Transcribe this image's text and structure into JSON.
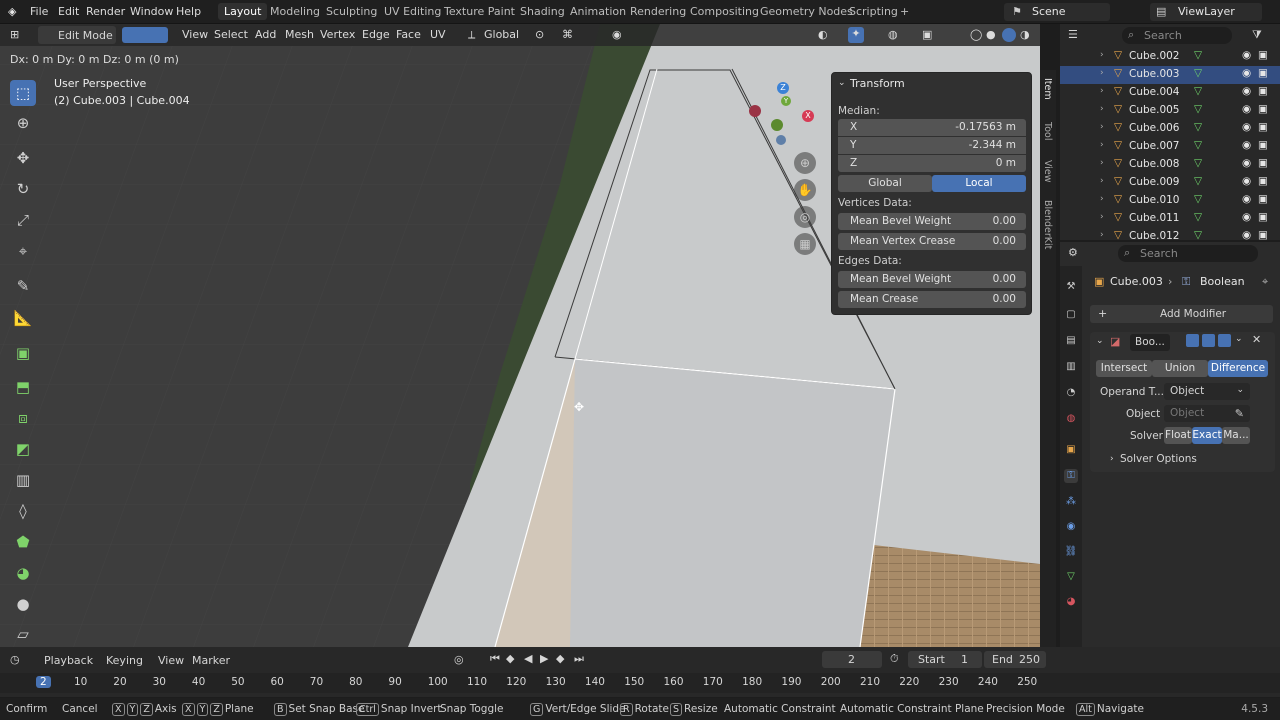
{
  "topbar": {
    "menus": [
      "File",
      "Edit",
      "Render",
      "Window",
      "Help"
    ],
    "workspaces": [
      "Layout",
      "Modeling",
      "Sculpting",
      "UV Editing",
      "Texture Paint",
      "Shading",
      "Animation",
      "Rendering",
      "Compositing",
      "Geometry Nodes",
      "Scripting"
    ],
    "active_workspace": "Layout",
    "add_workspace": "+",
    "scene": "Scene",
    "view_layer": "ViewLayer"
  },
  "viewport_header": {
    "mode": "Edit Mode",
    "menus": [
      "View",
      "Select",
      "Add",
      "Mesh",
      "Vertex",
      "Edge",
      "Face",
      "UV"
    ],
    "orientation": "Global"
  },
  "viewport": {
    "operator_status": "Dx: 0 m   Dy: 0 m   Dz: 0 m (0 m)",
    "perspective": "User Perspective",
    "object_info": "(2) Cube.003 | Cube.004",
    "gizmo_axes": [
      "Z",
      "Y",
      "X"
    ]
  },
  "npanel": {
    "title": "Transform",
    "median_label": "Median:",
    "x_label": "X",
    "x_value": "-0.17563 m",
    "y_label": "Y",
    "y_value": "-2.344 m",
    "z_label": "Z",
    "z_value": "0 m",
    "global_label": "Global",
    "local_label": "Local",
    "vertices_data_label": "Vertices Data:",
    "v_bevel_label": "Mean Bevel Weight",
    "v_bevel_value": "0.00",
    "v_crease_label": "Mean Vertex Crease",
    "v_crease_value": "0.00",
    "edges_data_label": "Edges Data:",
    "e_bevel_label": "Mean Bevel Weight",
    "e_bevel_value": "0.00",
    "e_crease_label": "Mean Crease",
    "e_crease_value": "0.00",
    "tabs": [
      "Item",
      "Tool",
      "View",
      "BlenderKit"
    ]
  },
  "outliner": {
    "search_placeholder": "Search",
    "items": [
      {
        "name": "Cube.002",
        "selected": false
      },
      {
        "name": "Cube.003",
        "selected": true
      },
      {
        "name": "Cube.004",
        "selected": false
      },
      {
        "name": "Cube.005",
        "selected": false
      },
      {
        "name": "Cube.006",
        "selected": false
      },
      {
        "name": "Cube.007",
        "selected": false
      },
      {
        "name": "Cube.008",
        "selected": false
      },
      {
        "name": "Cube.009",
        "selected": false
      },
      {
        "name": "Cube.010",
        "selected": false
      },
      {
        "name": "Cube.011",
        "selected": false
      },
      {
        "name": "Cube.012",
        "selected": false
      }
    ]
  },
  "properties": {
    "search_placeholder": "Search",
    "object_name": "Cube.003",
    "modifier_crumb": "Boolean",
    "add_modifier": "Add Modifier",
    "modifier_name": "Boo...",
    "op_intersect": "Intersect",
    "op_union": "Union",
    "op_difference": "Difference",
    "operand_type_label": "Operand T...",
    "operand_type_value": "Object",
    "object_label": "Object",
    "object_placeholder": "Object",
    "solver_label": "Solver",
    "solver_float": "Float",
    "solver_exact": "Exact",
    "solver_manifold": "Ma...",
    "solver_options": "Solver Options"
  },
  "timeline": {
    "menus": [
      "Playback",
      "Keying",
      "View",
      "Marker"
    ],
    "current_frame": "2",
    "start_label": "Start",
    "start_value": "1",
    "end_label": "End",
    "end_value": "250",
    "ruler": [
      "2",
      "10",
      "20",
      "30",
      "40",
      "50",
      "60",
      "70",
      "80",
      "90",
      "100",
      "110",
      "120",
      "130",
      "140",
      "150",
      "160",
      "170",
      "180",
      "190",
      "200",
      "210",
      "220",
      "230",
      "240",
      "250"
    ]
  },
  "statusbar": {
    "items": [
      {
        "keys": [],
        "label": "Confirm"
      },
      {
        "keys": [],
        "label": "Cancel"
      },
      {
        "keys": [
          "X",
          "Y",
          "Z"
        ],
        "label": "Axis"
      },
      {
        "keys": [
          "X",
          "Y",
          "Z"
        ],
        "label": "Plane"
      },
      {
        "keys": [
          "B"
        ],
        "label": "Set Snap Base"
      },
      {
        "keys": [
          "Ctrl"
        ],
        "label": "Snap Invert"
      },
      {
        "keys": [],
        "label": "Snap Toggle"
      },
      {
        "keys": [
          "G"
        ],
        "label": "Vert/Edge Slide"
      },
      {
        "keys": [
          "R"
        ],
        "label": "Rotate"
      },
      {
        "keys": [
          "S"
        ],
        "label": "Resize"
      },
      {
        "keys": [],
        "label": "Automatic Constraint"
      },
      {
        "keys": [],
        "label": "Automatic Constraint Plane"
      },
      {
        "keys": [],
        "label": "Precision Mode"
      },
      {
        "keys": [
          "Alt"
        ],
        "label": "Navigate"
      }
    ],
    "version": "4.5.3"
  }
}
